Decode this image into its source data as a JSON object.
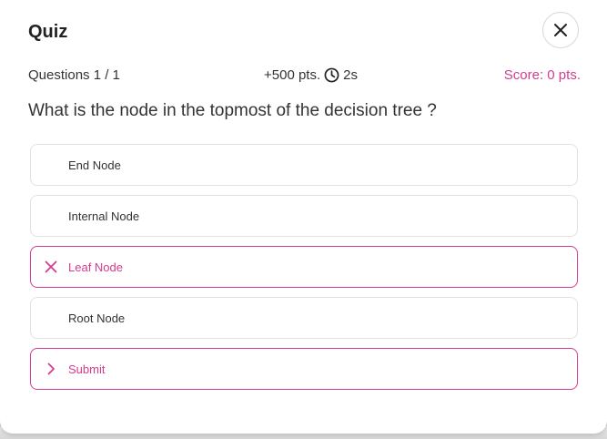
{
  "modal": {
    "title": "Quiz",
    "close_icon": "close-icon"
  },
  "meta": {
    "questions": "Questions 1 / 1",
    "points": "+500 pts.",
    "timer_icon": "clock-icon",
    "time": "2s",
    "score": "Score: 0 pts."
  },
  "question": {
    "text": "What is the node in the topmost of the decision tree ?"
  },
  "options": [
    {
      "label": "End Node",
      "state": "default"
    },
    {
      "label": "Internal Node",
      "state": "default"
    },
    {
      "label": "Leaf Node",
      "state": "wrong",
      "icon": "x-icon"
    },
    {
      "label": "Root Node",
      "state": "default"
    }
  ],
  "submit": {
    "label": "Submit",
    "icon": "chevron-right-icon"
  },
  "colors": {
    "accent": "#d63b8f",
    "text": "#333333",
    "border": "#e2e2e2"
  }
}
